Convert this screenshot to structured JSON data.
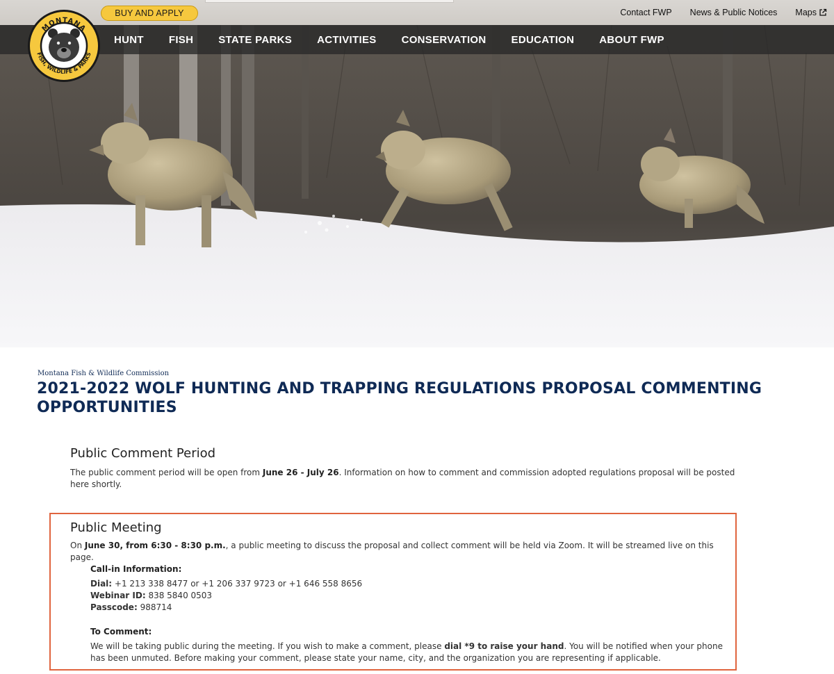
{
  "header": {
    "buy_label": "BUY AND APPLY",
    "util_links": [
      "Contact FWP",
      "News & Public Notices",
      "Maps"
    ],
    "logo": {
      "top_text": "MONTANA",
      "bottom_text": "FISH, WILDLIFE & PARKS",
      "icon": "bear-logo-icon"
    },
    "nav": [
      "HUNT",
      "FISH",
      "STATE PARKS",
      "ACTIVITIES",
      "CONSERVATION",
      "EDUCATION",
      "ABOUT FWP"
    ]
  },
  "hero": {
    "icon": "wolves-in-snow-photo"
  },
  "content": {
    "kicker": "Montana Fish & Wildlife Commission",
    "title": "2021-2022 WOLF HUNTING AND TRAPPING REGULATIONS  PROPOSAL COMMENTING OPPORTUNITIES",
    "comment_period": {
      "heading": "Public Comment Period",
      "pre": "The public comment period will be open from ",
      "bold": "June 26 - July 26",
      "post": ". Information on how to comment and commission adopted regulations proposal will be posted here shortly."
    },
    "meeting": {
      "heading": "Public Meeting",
      "pre": "On ",
      "bold": "June 30, from 6:30 - 8:30 p.m.",
      "post": ", a public meeting to discuss the proposal and collect comment will be held via Zoom. It will be streamed live on this page.",
      "callin_heading": "Call-in Information:",
      "dial_label": "Dial:",
      "dial_value": " +1 213 338 8477 or +1 206 337 9723 or +1 646 558 8656",
      "webinar_label": "Webinar ID:",
      "webinar_value": " 838 5840 0503",
      "passcode_label": "Passcode:",
      "passcode_value": " 988714",
      "comment_heading": "To Comment:",
      "comment_pre": "We will be taking public during the meeting. If you wish to make a comment, please ",
      "comment_bold": "dial *9 to raise your hand",
      "comment_post": ". You will be notified when your phone has been unmuted. Before making your comment, please state your name, city, and the organization you are representing if applicable."
    }
  },
  "colors": {
    "title_blue": "#0f2a55",
    "gold": "#f6c83e",
    "highlight_border": "#e0643e",
    "nav_bg": "#2a2a2a"
  }
}
